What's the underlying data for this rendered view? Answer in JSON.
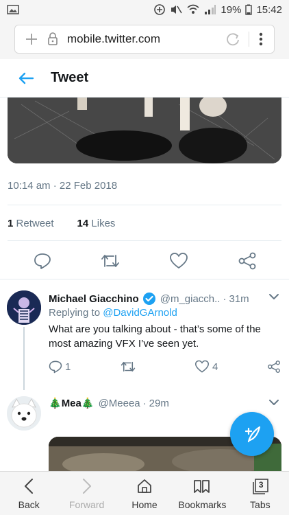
{
  "status_bar": {
    "battery": "19%",
    "time": "15:42"
  },
  "browser": {
    "url": "mobile.twitter.com"
  },
  "header": {
    "title": "Tweet"
  },
  "tweet": {
    "timestamp": "10:14 am · 22 Feb 2018",
    "retweets_count": "1",
    "retweets_label": "Retweet",
    "likes_count": "14",
    "likes_label": "Likes"
  },
  "replies": [
    {
      "name": "Michael Giacchino",
      "handle": "@m_giacch..",
      "time": "31m",
      "replying_prefix": "Replying to",
      "replying_to": "@DavidGArnold",
      "text": "What are you talking about - that’s some of the most amazing VFX I’ve seen yet.",
      "reply_count": "1",
      "like_count": "4"
    },
    {
      "name": "Mea",
      "emoji": "🎄",
      "handle": "@Meeea",
      "time": "29m"
    }
  ],
  "bottom_nav": {
    "back": "Back",
    "forward": "Forward",
    "home": "Home",
    "bookmarks": "Bookmarks",
    "tabs": "Tabs",
    "tabs_count": "3"
  },
  "colors": {
    "accent": "#1da1f2",
    "muted": "#657786"
  }
}
